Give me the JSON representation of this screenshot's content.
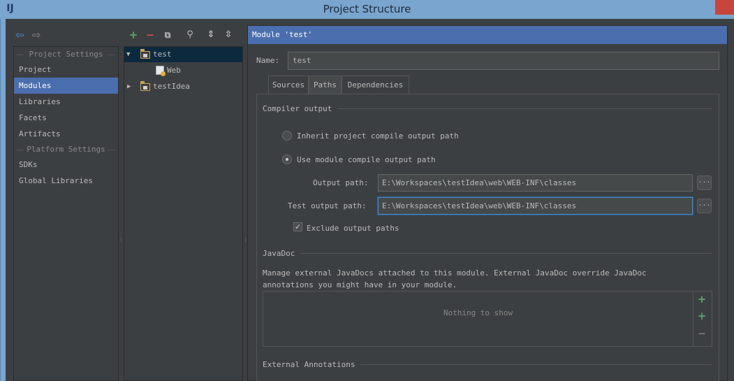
{
  "window": {
    "title": "Project Structure",
    "app_icon": "IJ"
  },
  "nav": {
    "back_icon": "arrow-left-icon",
    "forward_icon": "arrow-right-icon",
    "sections": [
      {
        "title": "Project Settings",
        "items": [
          "Project",
          "Modules",
          "Libraries",
          "Facets",
          "Artifacts"
        ]
      },
      {
        "title": "Platform Settings",
        "items": [
          "SDKs",
          "Global Libraries"
        ]
      }
    ],
    "selected": "Modules"
  },
  "tree_toolbar": {
    "buttons": [
      "add-icon",
      "remove-icon",
      "copy-icon",
      "find-icon",
      "expand-all-icon",
      "collapse-all-icon"
    ]
  },
  "tree": {
    "nodes": [
      {
        "label": "test",
        "expanded": true,
        "selected": true
      },
      {
        "label": "Web",
        "child": true
      },
      {
        "label": "testIdea",
        "expanded": false
      }
    ]
  },
  "module": {
    "header": "Module 'test'",
    "name_label": "Name:",
    "name_value": "test",
    "tabs": [
      "Sources",
      "Paths",
      "Dependencies"
    ],
    "active_tab": "Paths",
    "compiler_output": {
      "title": "Compiler output",
      "inherit_label": "Inherit project compile output path",
      "use_module_label": "Use module compile output path",
      "selected": "use_module",
      "output_path_label": "Output path:",
      "output_path": "E:\\Workspaces\\testIdea\\web\\WEB-INF\\classes",
      "test_output_path_label": "Test output path:",
      "test_output_path": "E:\\Workspaces\\testIdea\\web\\WEB-INF\\classes",
      "browse_label": "...",
      "exclude_label": "Exclude output paths",
      "exclude_checked": true
    },
    "javadoc": {
      "title": "JavaDoc",
      "description_line1": "Manage external JavaDocs attached to this module. External JavaDoc override JavaDoc",
      "description_line2": "annotations you might have in your module.",
      "empty_text": "Nothing to show"
    },
    "external_annotations": {
      "title": "External Annotations"
    }
  },
  "colors": {
    "background": "#3c3f41",
    "selection": "#4b6eaf",
    "tree_selection": "#0d293e",
    "title_bar": "#7aa5cf",
    "add_green": "#59a869",
    "remove_red": "#c75450"
  }
}
